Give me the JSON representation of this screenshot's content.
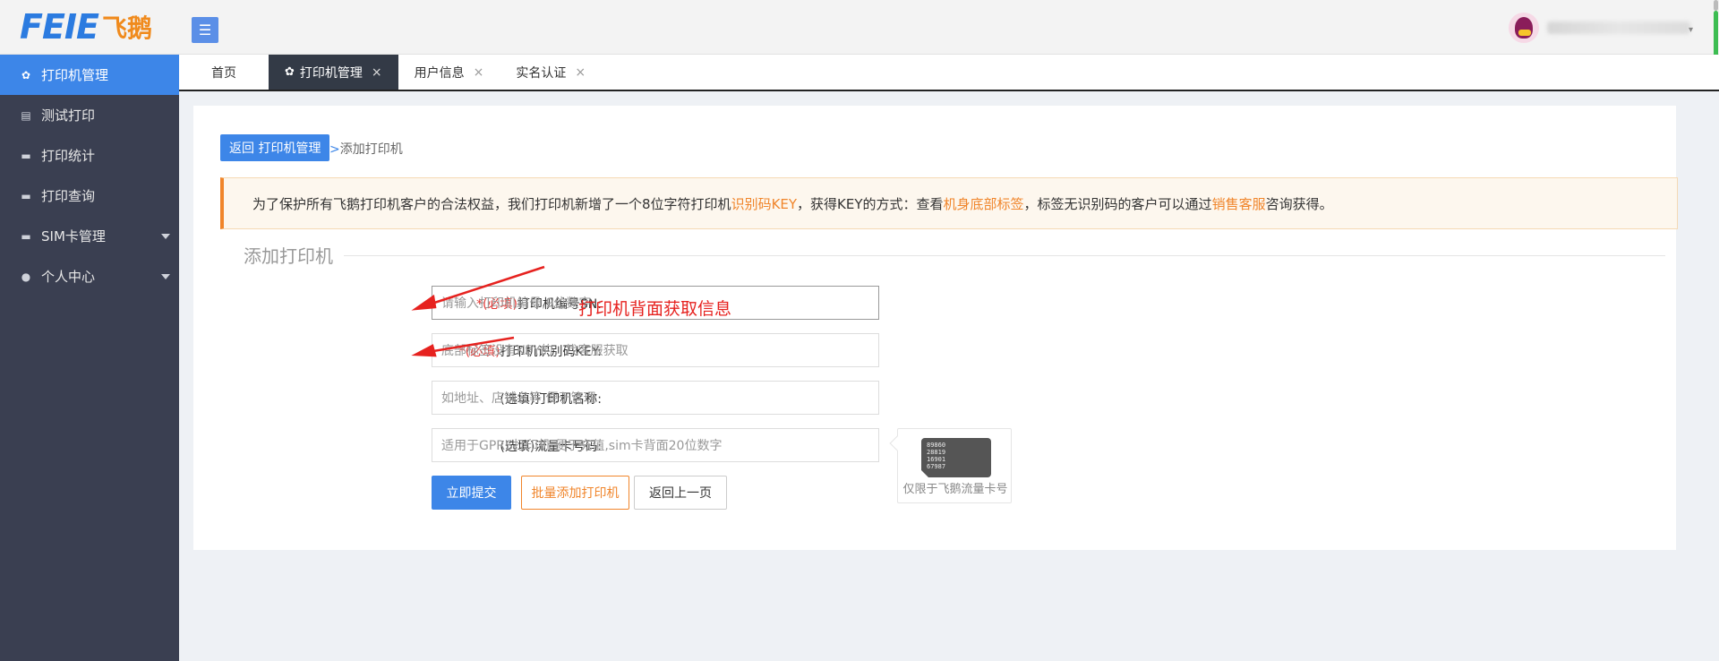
{
  "header": {
    "logo_en": "FEIE",
    "logo_cn": "飞鹅",
    "menu_toggle_icon": "hamburger-icon"
  },
  "sidebar": {
    "items": [
      {
        "label": "打印机管理",
        "icon": "printer-cluster-icon",
        "active": true
      },
      {
        "label": "测试打印",
        "icon": "document-icon"
      },
      {
        "label": "打印统计",
        "icon": "monitor-icon"
      },
      {
        "label": "打印查询",
        "icon": "monitor-icon"
      },
      {
        "label": "SIM卡管理",
        "icon": "monitor-icon",
        "has_submenu": true
      },
      {
        "label": "个人中心",
        "icon": "user-icon",
        "has_submenu": true
      }
    ]
  },
  "tabs": [
    {
      "label": "首页"
    },
    {
      "label": "打印机管理",
      "active": true,
      "close": "×"
    },
    {
      "label": "用户信息",
      "close": "×"
    },
    {
      "label": "实名认证",
      "close": "×"
    }
  ],
  "breadcrumb": {
    "back_label": "返回 打印机管理",
    "separator": ">",
    "current": "添加打印机"
  },
  "notice": {
    "part1": "为了保护所有飞鹅打印机客户的合法权益，我们打印机新增了一个8位字符打印机",
    "hl1": "识别码KEY",
    "part2": "，获得KEY的方式：查看",
    "hl2": "机身底部标签",
    "part3": "，标签无识别码的客户可以通过",
    "hl3": "销售客服",
    "part4": "咨询获得。"
  },
  "form": {
    "section_title": "添加打印机",
    "fields": [
      {
        "required_mark": "*(必填)",
        "label": "打印机编号SN:",
        "placeholder": "请输入打印机编号,9位数字"
      },
      {
        "required_mark": "*(必填)",
        "label": "打印机识别码KEY:",
        "placeholder": "底部标签没有KEY的，找客服获取"
      },
      {
        "required_mark": "",
        "label": "(选填)打印机名称:",
        "placeholder": "如地址、店铺名等,便于管理"
      },
      {
        "required_mark": "",
        "label": "(选填)流量卡号码:",
        "placeholder": "适用于GPRS打印机,便于充值,sim卡背面20位数字"
      }
    ],
    "submit_label": "立即提交",
    "batch_label": "批量添加打印机",
    "back_label": "返回上一页"
  },
  "sim_tip": {
    "card_lines": [
      "89860",
      "28819",
      "16901",
      "67987"
    ],
    "note": "仅限于飞鹅流量卡号"
  },
  "annotation_text": "打印机背面获取信息",
  "colors": {
    "accent": "#3d86e8",
    "orange": "#f0852b",
    "sidebar_bg": "#3a3f51",
    "annotation": "#e6221f"
  }
}
